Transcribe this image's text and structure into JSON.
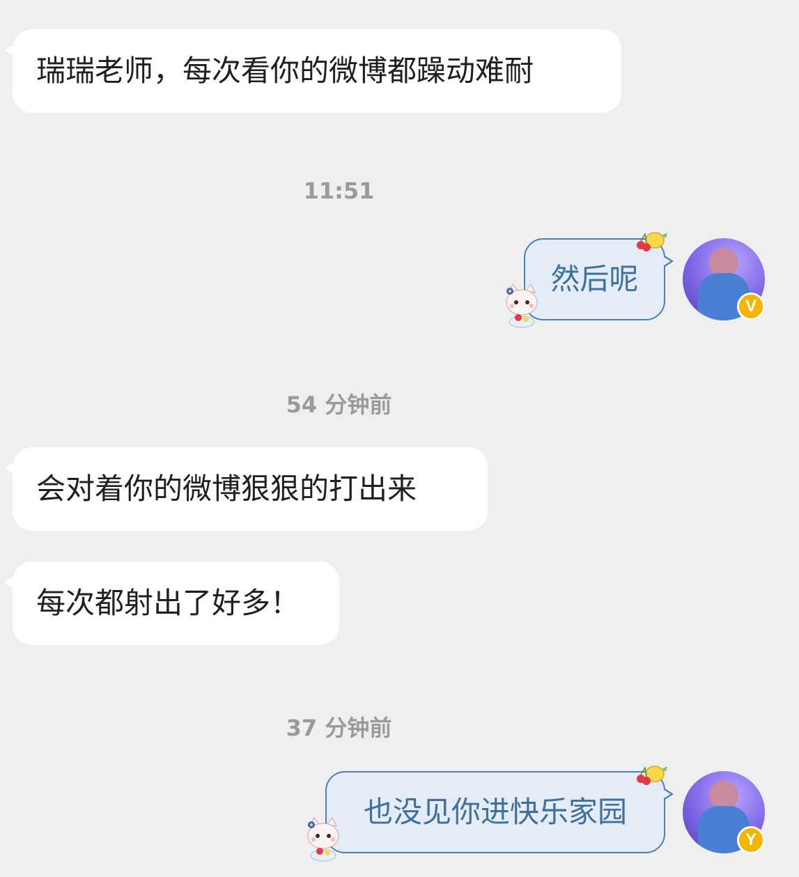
{
  "messages": [
    {
      "side": "left",
      "text": "瑞瑞老师，每次看你的微博都躁动难耐"
    },
    {
      "side": "right",
      "text": "然后呢"
    },
    {
      "side": "left",
      "text": "会对着你的微博狠狠的打出来"
    },
    {
      "side": "left",
      "text": "每次都射出了好多！"
    },
    {
      "side": "right",
      "text": "也没见你进快乐家园"
    }
  ],
  "timestamps": [
    "11:51",
    "54 分钟前",
    "37 分钟前"
  ],
  "badges": {
    "verified_1": "V",
    "verified_2": "Y"
  },
  "colors": {
    "background": "#efefef",
    "left_bubble": "#ffffff",
    "right_bubble": "#e4edf7",
    "right_bubble_border": "#4d7fb3",
    "right_text": "#3f6f9c",
    "timestamp": "#9a9a9a",
    "verified": "#f5b400"
  },
  "icons": [
    "cherry-lemon-sticker-icon",
    "cat-mascot-sticker-icon",
    "verified-badge-icon"
  ]
}
